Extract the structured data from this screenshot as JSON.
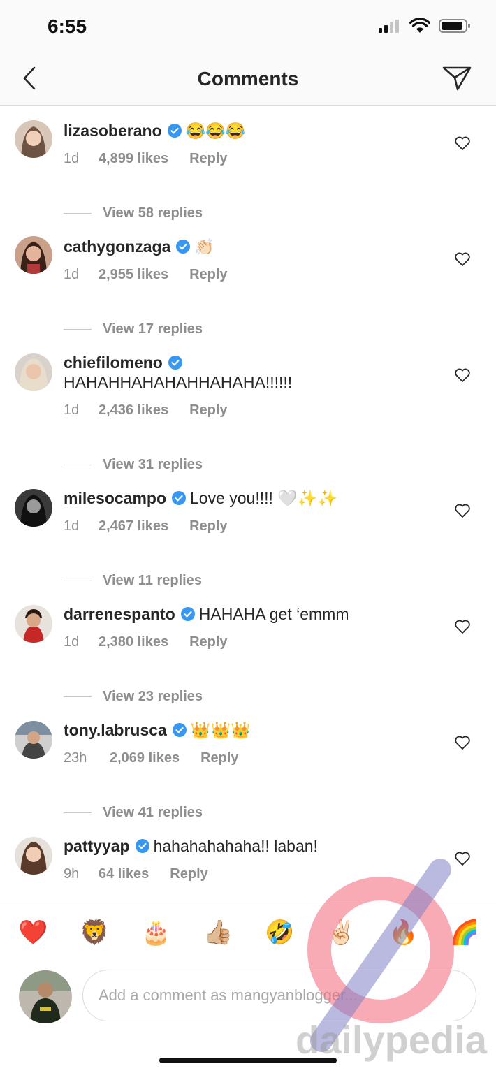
{
  "status_bar": {
    "time": "6:55"
  },
  "nav": {
    "title": "Comments"
  },
  "comments": [
    {
      "username": "lizasoberano",
      "text": "😂😂😂",
      "time": "1d",
      "likes": "4,899 likes",
      "reply": "Reply",
      "view_replies": "View 58 replies"
    },
    {
      "username": "cathygonzaga",
      "text": "👏🏻",
      "time": "1d",
      "likes": "2,955 likes",
      "reply": "Reply",
      "view_replies": "View 17 replies"
    },
    {
      "username": "chiefilomeno",
      "text": "HAHAHHAHAHAHHAHAHA!!!!!!",
      "time": "1d",
      "likes": "2,436 likes",
      "reply": "Reply",
      "view_replies": "View 31 replies"
    },
    {
      "username": "milesocampo",
      "text": "Love you!!!! 🤍✨✨",
      "time": "1d",
      "likes": "2,467 likes",
      "reply": "Reply",
      "view_replies": "View 11 replies"
    },
    {
      "username": "darrenespanto",
      "text": "HAHAHA get ‘emmm",
      "time": "1d",
      "likes": "2,380 likes",
      "reply": "Reply",
      "view_replies": "View 23 replies"
    },
    {
      "username": "tony.labrusca",
      "text": "👑👑👑",
      "time": "23h",
      "likes": "2,069 likes",
      "reply": "Reply",
      "view_replies": "View 41 replies"
    },
    {
      "username": "pattyyap",
      "text": "hahahahahaha!! laban!",
      "time": "9h",
      "likes": "64 likes",
      "reply": "Reply"
    }
  ],
  "emoji_bar": [
    "❤️",
    "🦁",
    "🎂",
    "👍🏼",
    "🤣",
    "✌🏻",
    "🔥",
    "🌈"
  ],
  "composer": {
    "placeholder": "Add a comment as mangyanblogger..."
  },
  "watermark": {
    "text": "dailypedia"
  },
  "colors": {
    "verified": "#3897f0",
    "muted": "#8e8e8e",
    "text": "#262626",
    "divider": "#dbdbdb"
  }
}
